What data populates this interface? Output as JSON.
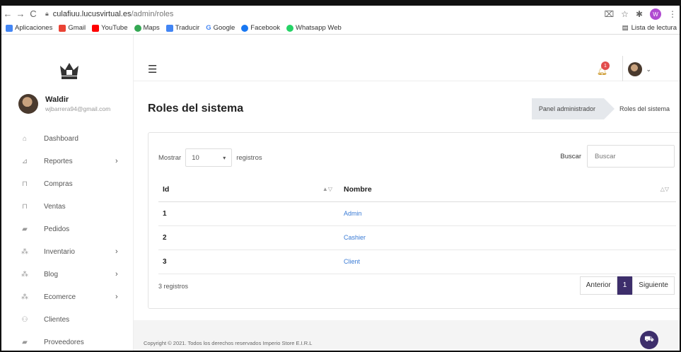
{
  "browser": {
    "url_domain": "culafiuu.lucusvirtual.es",
    "url_path": "/admin/roles",
    "bookmarks": [
      {
        "label": "Aplicaciones",
        "color": "#4285f4"
      },
      {
        "label": "Gmail",
        "color": "#ea4335"
      },
      {
        "label": "YouTube",
        "color": "#ff0000"
      },
      {
        "label": "Maps",
        "color": "#34a853"
      },
      {
        "label": "Traducir",
        "color": "#4285f4"
      },
      {
        "label": "Google",
        "color": "#4285f4"
      },
      {
        "label": "Facebook",
        "color": "#1877f2"
      },
      {
        "label": "Whatsapp Web",
        "color": "#25d366"
      }
    ],
    "reading_list": "Lista de lectura",
    "profile_initial": "W"
  },
  "sidebar": {
    "user_name": "Waldir",
    "user_email": "wjbarrera94@gmail.com",
    "items": [
      {
        "label": "Dashboard",
        "icon": "home-icon",
        "has_children": false
      },
      {
        "label": "Reportes",
        "icon": "chart-icon",
        "has_children": true
      },
      {
        "label": "Compras",
        "icon": "cart-icon",
        "has_children": false
      },
      {
        "label": "Ventas",
        "icon": "cart-icon",
        "has_children": false
      },
      {
        "label": "Pedidos",
        "icon": "truck-icon",
        "has_children": false
      },
      {
        "label": "Inventario",
        "icon": "boxes-icon",
        "has_children": true
      },
      {
        "label": "Blog",
        "icon": "boxes-icon",
        "has_children": true
      },
      {
        "label": "Ecomerce",
        "icon": "boxes-icon",
        "has_children": true
      },
      {
        "label": "Clientes",
        "icon": "users-icon",
        "has_children": false
      },
      {
        "label": "Proveedores",
        "icon": "truck-icon",
        "has_children": false
      }
    ]
  },
  "topbar": {
    "notification_count": "1"
  },
  "page": {
    "title": "Roles del sistema",
    "breadcrumb": [
      "Panel administrador",
      "Roles del sistema"
    ]
  },
  "table": {
    "show_label": "Mostrar",
    "page_size": "10",
    "records_label": "registros",
    "search_label": "Buscar",
    "search_placeholder": "Buscar",
    "columns": [
      "Id",
      "Nombre"
    ],
    "rows": [
      {
        "id": "1",
        "name": "Admin"
      },
      {
        "id": "2",
        "name": "Cashier"
      },
      {
        "id": "3",
        "name": "Client"
      }
    ],
    "info": "3 registros",
    "pager": {
      "prev": "Anterior",
      "current": "1",
      "next": "Siguiente"
    }
  },
  "footer": {
    "copyright": "Copyright © 2021. Todos los derechos reservados Imperio Store E.I.R.L"
  }
}
